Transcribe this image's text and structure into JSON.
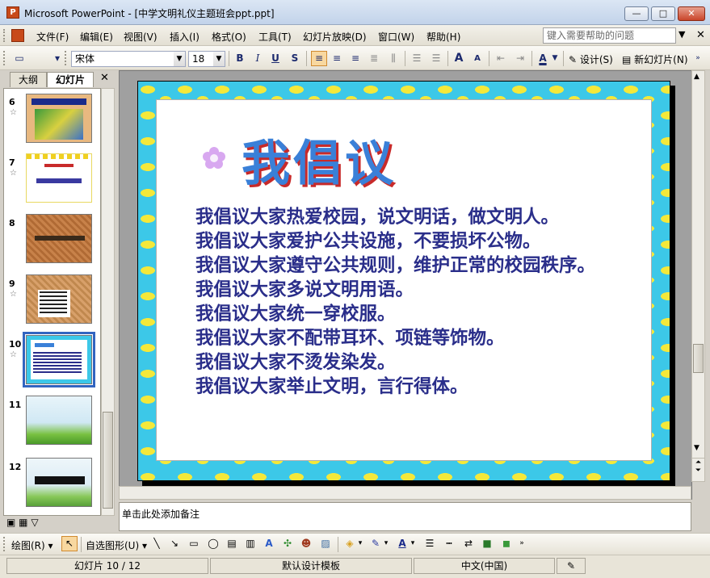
{
  "window": {
    "title": "Microsoft PowerPoint - [中学文明礼仪主题班会ppt.ppt]",
    "app_icon_label": "P",
    "minimize": "—",
    "maximize": "□",
    "close": "✕"
  },
  "menu": {
    "items": [
      "文件(F)",
      "编辑(E)",
      "视图(V)",
      "插入(I)",
      "格式(O)",
      "工具(T)",
      "幻灯片放映(D)",
      "窗口(W)",
      "帮助(H)"
    ],
    "help_placeholder": "键入需要帮助的问题",
    "close_glyph": "✕"
  },
  "toolbar": {
    "font_name": "宋体",
    "font_size": "18",
    "bold": "B",
    "italic": "I",
    "underline": "U",
    "shadow": "S",
    "font_color": "A",
    "design_label": "设计(S)",
    "new_slide_label": "新幻灯片(N)",
    "grow_font": "A",
    "shrink_font": "A"
  },
  "panel": {
    "tabs": [
      "大纲",
      "幻灯片"
    ],
    "close_glyph": "✕",
    "thumbnails": [
      {
        "num": "6"
      },
      {
        "num": "7"
      },
      {
        "num": "8"
      },
      {
        "num": "9"
      },
      {
        "num": "10",
        "selected": true
      },
      {
        "num": "11"
      },
      {
        "num": "12"
      }
    ],
    "thumb_star": "☆"
  },
  "slide": {
    "title": "我倡议",
    "lines": [
      "我倡议大家热爱校园，说文明话，做文明人。",
      "我倡议大家爱护公共设施，不要损坏公物。",
      "我倡议大家遵守公共规则，维护正常的校园秩序。",
      "我倡议大家多说文明用语。",
      "我倡议大家统一穿校服。",
      "我倡议大家不配带耳环、项链等饰物。",
      "我倡议大家不烫发染发。",
      "我倡议大家举止文明，言行得体。"
    ],
    "title_color": "#3a80d8",
    "title_shadow_color": "#c82a2a",
    "text_color": "#2a2e8a",
    "frame_color": "#3cc8e8",
    "dot_color": "#f4e83a"
  },
  "notes": {
    "placeholder": "单击此处添加备注"
  },
  "drawbar": {
    "draw_label": "绘图(R)",
    "autoshapes_label": "自选图形(U)"
  },
  "status": {
    "slide_counter": "幻灯片 10 / 12",
    "template": "默认设计模板",
    "language": "中文(中国)"
  }
}
